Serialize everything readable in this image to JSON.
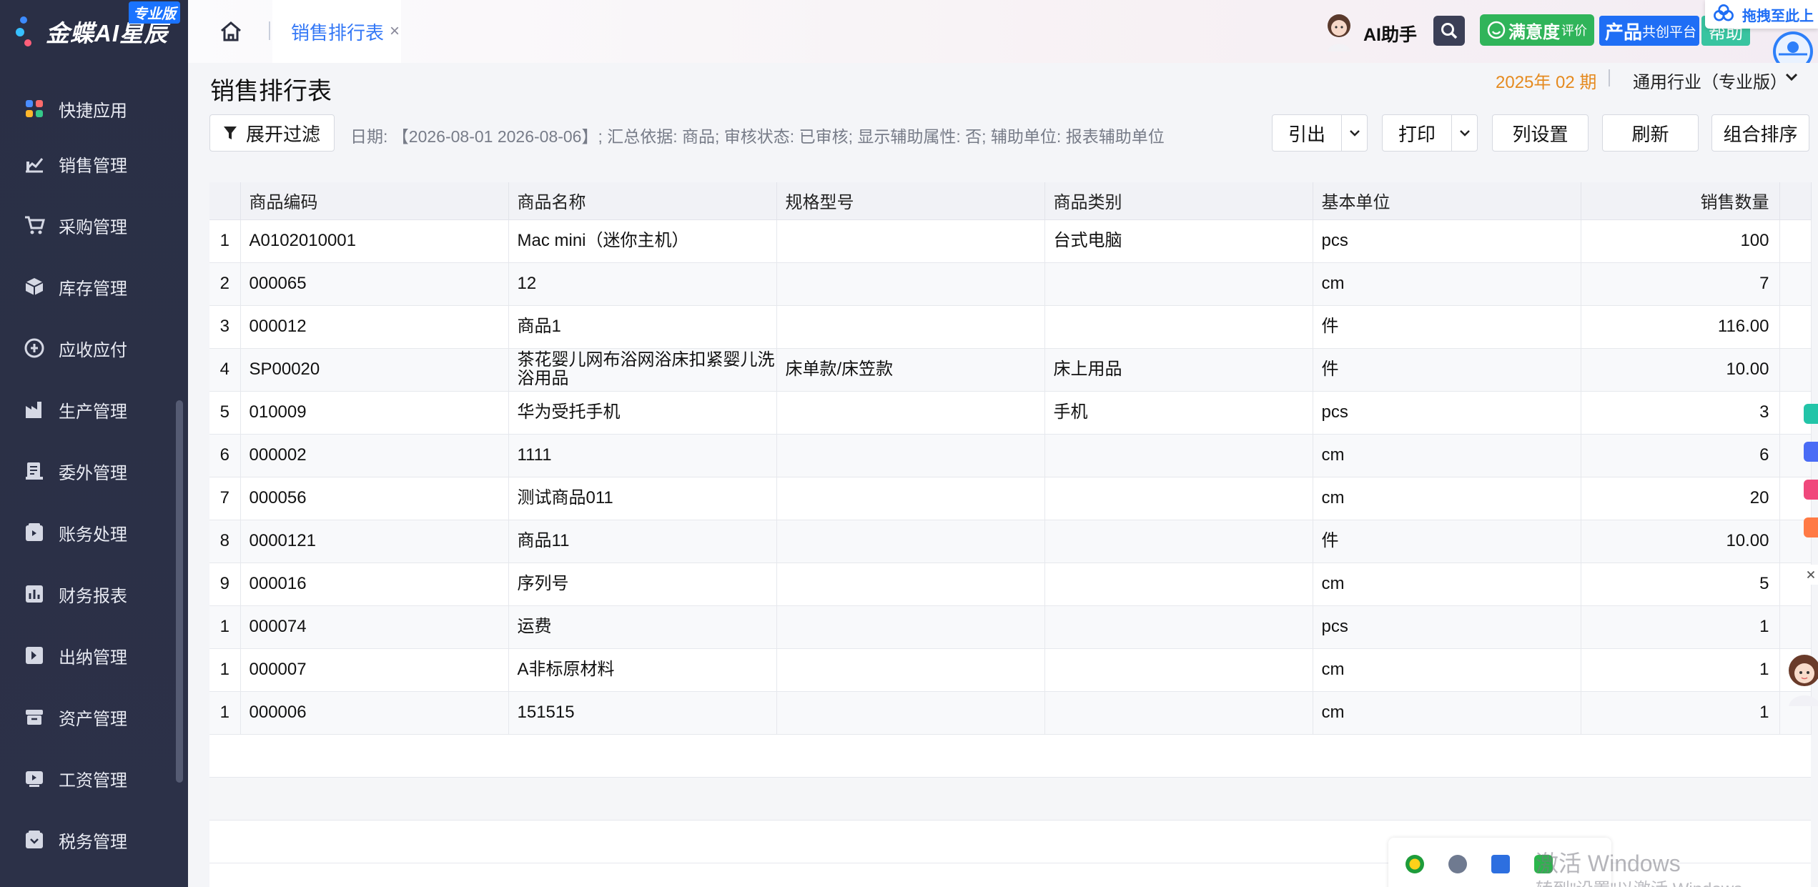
{
  "app": {
    "logo_text": "金蝶AI星辰",
    "logo_badge": "专业版"
  },
  "sidebar": {
    "items": [
      {
        "label": "快捷应用",
        "icon": "apps-icon"
      },
      {
        "label": "销售管理",
        "icon": "sales-chart-icon"
      },
      {
        "label": "采购管理",
        "icon": "cart-icon"
      },
      {
        "label": "库存管理",
        "icon": "box-icon"
      },
      {
        "label": "应收应付",
        "icon": "receivable-icon"
      },
      {
        "label": "生产管理",
        "icon": "factory-icon"
      },
      {
        "label": "委外管理",
        "icon": "outsource-icon"
      },
      {
        "label": "账务处理",
        "icon": "ledger-icon"
      },
      {
        "label": "财务报表",
        "icon": "report-icon"
      },
      {
        "label": "出纳管理",
        "icon": "cashier-icon"
      },
      {
        "label": "资产管理",
        "icon": "asset-icon"
      },
      {
        "label": "工资管理",
        "icon": "salary-icon"
      },
      {
        "label": "税务管理",
        "icon": "tax-icon"
      }
    ]
  },
  "header": {
    "tab_label": "销售排行表",
    "tab_close": "×",
    "ai_label": "AI助手",
    "satisfaction_label": "满意度",
    "satisfaction_sub": "评价",
    "product_label": "产品",
    "product_sub": "共创平台",
    "help_label": "帮助",
    "drag_label": "拖拽至此上"
  },
  "page": {
    "title": "销售排行表",
    "period": "2025年 02 期",
    "industry": "通用行业（专业版）"
  },
  "toolbar": {
    "filter_label": "展开过滤",
    "filter_info": "日期: 【2026-08-01 2026-08-06】; 汇总依据: 商品; 审核状态: 已审核; 显示辅助属性: 否; 辅助单位: 报表辅助单位",
    "export_label": "引出",
    "print_label": "打印",
    "columns_label": "列设置",
    "refresh_label": "刷新",
    "sort_label": "组合排序"
  },
  "table": {
    "columns": [
      "商品编码",
      "商品名称",
      "规格型号",
      "商品类别",
      "基本单位",
      "销售数量"
    ],
    "rows": [
      {
        "idx": "1",
        "code": "A0102010001",
        "name": "Mac mini（迷你主机）",
        "spec": "",
        "category": "台式电脑",
        "unit": "pcs",
        "qty": "100"
      },
      {
        "idx": "2",
        "code": "000065",
        "name": "12",
        "spec": "",
        "category": "",
        "unit": "cm",
        "qty": "7"
      },
      {
        "idx": "3",
        "code": "000012",
        "name": "商品1",
        "spec": "",
        "category": "",
        "unit": "件",
        "qty": "116.00"
      },
      {
        "idx": "4",
        "code": "SP00020",
        "name": "茶花婴儿网布浴网浴床扣紧婴儿洗浴用品",
        "spec": "床单款/床笠款",
        "category": "床上用品",
        "unit": "件",
        "qty": "10.00"
      },
      {
        "idx": "5",
        "code": "010009",
        "name": "华为受托手机",
        "spec": "",
        "category": "手机",
        "unit": "pcs",
        "qty": "3"
      },
      {
        "idx": "6",
        "code": "000002",
        "name": "1111",
        "spec": "",
        "category": "",
        "unit": "cm",
        "qty": "6"
      },
      {
        "idx": "7",
        "code": "000056",
        "name": "测试商品011",
        "spec": "",
        "category": "",
        "unit": "cm",
        "qty": "20"
      },
      {
        "idx": "8",
        "code": "0000121",
        "name": "商品11",
        "spec": "",
        "category": "",
        "unit": "件",
        "qty": "10.00"
      },
      {
        "idx": "9",
        "code": "000016",
        "name": "序列号",
        "spec": "",
        "category": "",
        "unit": "cm",
        "qty": "5"
      },
      {
        "idx": "1",
        "code": "000074",
        "name": "运费",
        "spec": "",
        "category": "",
        "unit": "pcs",
        "qty": "1"
      },
      {
        "idx": "1",
        "code": "000007",
        "name": "A非标原材料",
        "spec": "",
        "category": "",
        "unit": "cm",
        "qty": "1"
      },
      {
        "idx": "1",
        "code": "000006",
        "name": "151515",
        "spec": "",
        "category": "",
        "unit": "cm",
        "qty": "1"
      }
    ]
  },
  "watermark": {
    "line1": "激活 Windows",
    "line2": "转到\"设置\"以激活 Windows。"
  },
  "colors": {
    "sidebar_bg": "#2a2f45",
    "accent": "#3478f6",
    "period": "#e58a1f",
    "satisfaction": "#30b45a",
    "product": "#1f6ef5",
    "help": "#39c4a0"
  }
}
